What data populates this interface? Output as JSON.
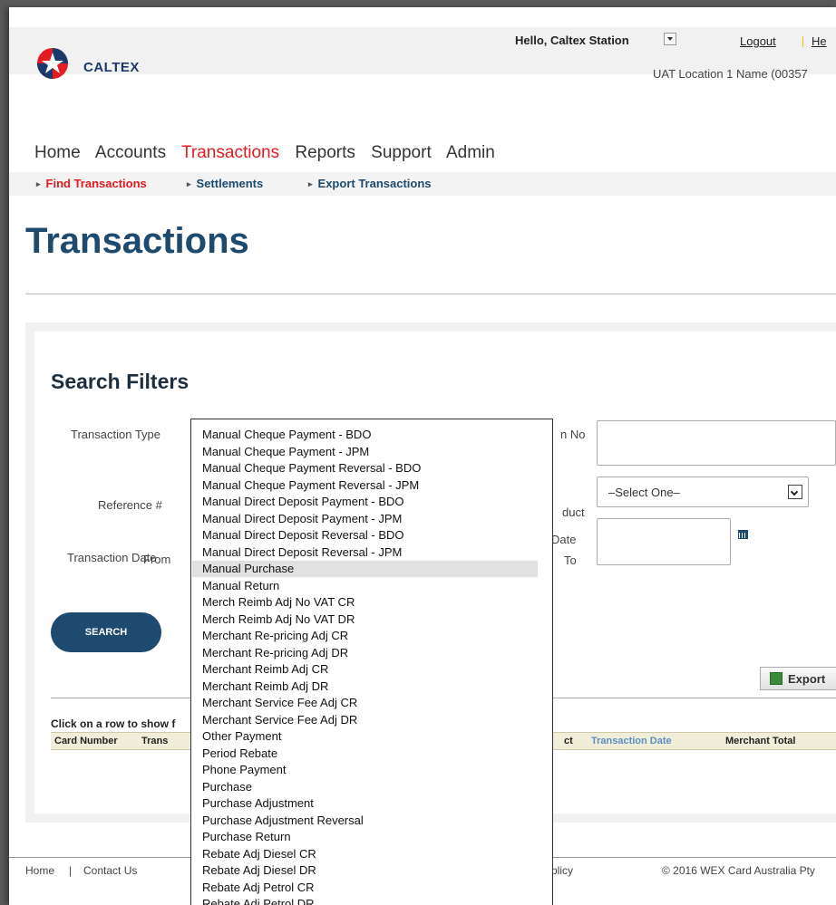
{
  "header": {
    "brand": "CALTEX",
    "greeting": "Hello, Caltex Station",
    "logout": "Logout",
    "help": "He",
    "location": "UAT Location 1 Name (00357"
  },
  "nav": {
    "items": [
      "Home",
      "Accounts",
      "Transactions",
      "Reports",
      "Support",
      "Admin"
    ],
    "active": "Transactions"
  },
  "subnav": {
    "items": [
      "Find Transactions",
      "Settlements",
      "Export Transactions"
    ]
  },
  "page": {
    "title": "Transactions"
  },
  "filters": {
    "title": "Search Filters",
    "transaction_type_label": "Transaction Type",
    "reference_label": "Reference #",
    "transaction_date_label": "Transaction Date",
    "from_label": "From",
    "right_no_label": "n No",
    "product_label": "duct",
    "date_label": "Date",
    "to_label": "To",
    "product_select_value": "–Select One–",
    "search_button": "SEARCH",
    "export_button": "Export"
  },
  "results": {
    "hint": "Click on a row to show f",
    "columns": [
      "Card Number",
      "Trans",
      "ct",
      "Transaction Date",
      "Merchant Total"
    ]
  },
  "footer": {
    "home": "Home",
    "separator": "|",
    "contact": "Contact Us",
    "policy": "blicy",
    "copyright": "©  2016 WEX Card Australia Pty"
  },
  "dropdown": {
    "selected": "Manual Purchase",
    "options": [
      "Manual Cheque Payment - BDO",
      "Manual Cheque Payment - JPM",
      "Manual Cheque Payment Reversal - BDO",
      "Manual Cheque Payment Reversal - JPM",
      "Manual Direct Deposit Payment - BDO",
      "Manual Direct Deposit Payment - JPM",
      "Manual Direct Deposit Reversal - BDO",
      "Manual Direct Deposit Reversal - JPM",
      "Manual Purchase",
      "Manual Return",
      "Merch Reimb Adj No VAT CR",
      "Merch Reimb Adj No VAT DR",
      "Merchant Re-pricing Adj CR",
      "Merchant Re-pricing Adj DR",
      "Merchant Reimb Adj CR",
      "Merchant Reimb Adj DR",
      "Merchant Service Fee Adj CR",
      "Merchant Service Fee Adj DR",
      "Other Payment",
      "Period Rebate",
      "Phone Payment",
      "Purchase",
      "Purchase Adjustment",
      "Purchase Adjustment Reversal",
      "Purchase Return",
      "Rebate Adj Diesel CR",
      "Rebate Adj Diesel DR",
      "Rebate Adj Petrol CR",
      "Rebate Adj Petrol DR"
    ]
  },
  "colors": {
    "brand_red": "#e31b23",
    "brand_blue": "#1d4a6e"
  }
}
